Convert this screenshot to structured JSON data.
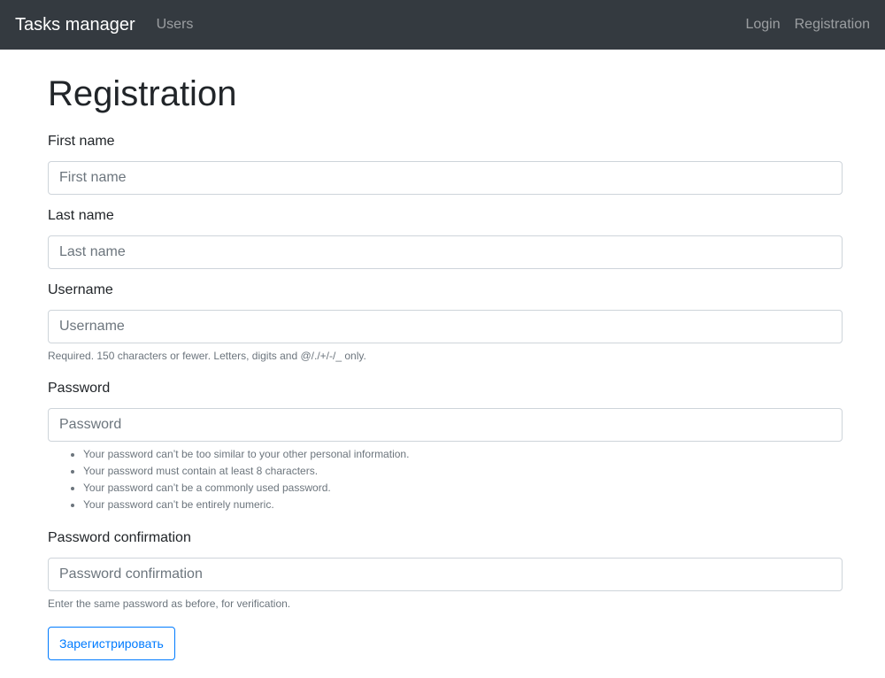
{
  "navbar": {
    "brand": "Tasks manager",
    "links_left": [
      "Users"
    ],
    "links_right": [
      "Login",
      "Registration"
    ]
  },
  "page": {
    "title": "Registration"
  },
  "form": {
    "first_name": {
      "label": "First name",
      "placeholder": "First name",
      "value": ""
    },
    "last_name": {
      "label": "Last name",
      "placeholder": "Last name",
      "value": ""
    },
    "username": {
      "label": "Username",
      "placeholder": "Username",
      "value": "",
      "help": "Required. 150 characters or fewer. Letters, digits and @/./+/-/_ only."
    },
    "password": {
      "label": "Password",
      "placeholder": "Password",
      "value": "",
      "help_items": [
        "Your password can’t be too similar to your other personal information.",
        "Your password must contain at least 8 characters.",
        "Your password can’t be a commonly used password.",
        "Your password can’t be entirely numeric."
      ]
    },
    "password_confirmation": {
      "label": "Password confirmation",
      "placeholder": "Password confirmation",
      "value": "",
      "help": "Enter the same password as before, for verification."
    },
    "submit_label": "Зарегистрировать"
  },
  "colors": {
    "navbar_bg": "#343a40",
    "accent": "#007bff"
  }
}
